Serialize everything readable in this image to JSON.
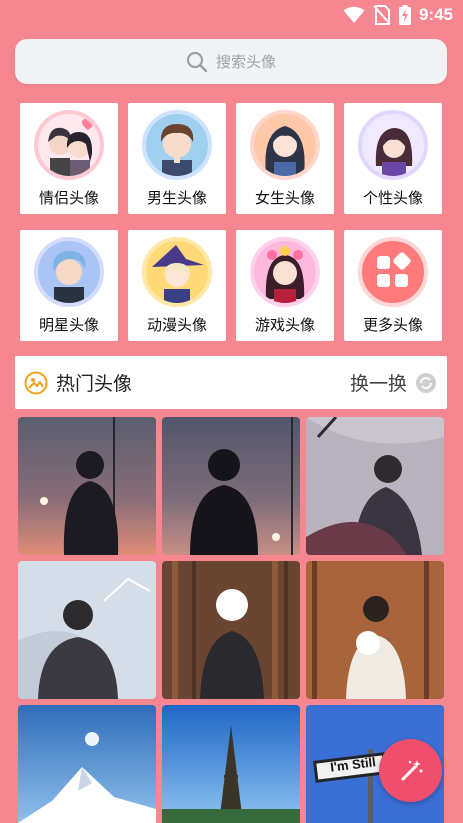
{
  "status": {
    "time": "9:45"
  },
  "search": {
    "placeholder": "搜索头像"
  },
  "categories": [
    {
      "label": "情侣头像",
      "ring": "#ffc9d2"
    },
    {
      "label": "男生头像",
      "ring": "#cfe2ff"
    },
    {
      "label": "女生头像",
      "ring": "#ffd6cc"
    },
    {
      "label": "个性头像",
      "ring": "#e4d7ff"
    },
    {
      "label": "明星头像",
      "ring": "#d3dcff"
    },
    {
      "label": "动漫头像",
      "ring": "#ffe7a6"
    },
    {
      "label": "游戏头像",
      "ring": "#ffd2ec"
    },
    {
      "label": "更多头像",
      "ring": "#ffd6d6"
    }
  ],
  "hot": {
    "title": "热门头像",
    "refresh_label": "换一换"
  },
  "photos": [
    {
      "name": "silhouette-sunset-boy"
    },
    {
      "name": "silhouette-dusk-boy"
    },
    {
      "name": "girl-with-veil"
    },
    {
      "name": "boy-with-net"
    },
    {
      "name": "boy-with-flowers-forest"
    },
    {
      "name": "boy-with-flowers-autumn"
    },
    {
      "name": "mountain-moon"
    },
    {
      "name": "eiffel-tower"
    },
    {
      "name": "im-still-sign",
      "sign_text": "I'm Still"
    }
  ]
}
